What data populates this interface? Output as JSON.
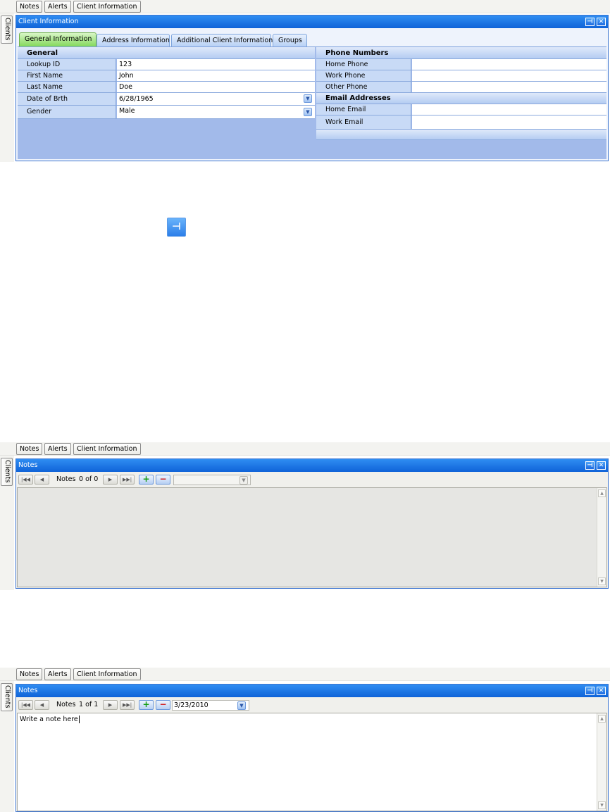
{
  "toolbar_tabs": [
    "Notes",
    "Alerts",
    "Client Information"
  ],
  "side_tab": "Clients",
  "screen1": {
    "panel_title": "Client Information",
    "tabs": [
      "General Information",
      "Address Information",
      "Additional Client Information",
      "Groups"
    ],
    "active_tab": "General Information",
    "general": {
      "header": "General",
      "fields": [
        {
          "label": "Lookup ID",
          "value": "123"
        },
        {
          "label": "First Name",
          "value": "John"
        },
        {
          "label": "Last Name",
          "value": "Doe"
        },
        {
          "label": "Date of Brth",
          "value": "6/28/1965"
        },
        {
          "label": "Gender",
          "value": "Male"
        }
      ]
    },
    "phone": {
      "header": "Phone Numbers",
      "fields": [
        {
          "label": "Home Phone",
          "value": ""
        },
        {
          "label": "Work Phone",
          "value": ""
        },
        {
          "label": "Other Phone",
          "value": ""
        }
      ]
    },
    "email": {
      "header": "Email Addresses",
      "fields": [
        {
          "label": "Home Email",
          "value": ""
        },
        {
          "label": "Work Email",
          "value": ""
        }
      ]
    }
  },
  "screen2": {
    "panel_title": "Notes",
    "nav_label": "Notes",
    "nav_count": "0 of 0",
    "date": ""
  },
  "screen3": {
    "panel_title": "Notes",
    "nav_label": "Notes",
    "nav_count": "1 of 1",
    "date": "3/23/2010",
    "note_text": "Write a note here"
  },
  "icons": {
    "pin": "pin-icon",
    "close": "close-icon",
    "first": "first-record-icon",
    "prev": "prev-record-icon",
    "next": "next-record-icon",
    "last": "last-record-icon",
    "add": "add-icon",
    "remove": "remove-icon",
    "dropdown": "chevron-down-icon"
  },
  "colors": {
    "title_bar": "#1874e4",
    "form_body": "#a2baea",
    "active_tab": "#83d85b",
    "label_cell": "#c8daf6"
  }
}
